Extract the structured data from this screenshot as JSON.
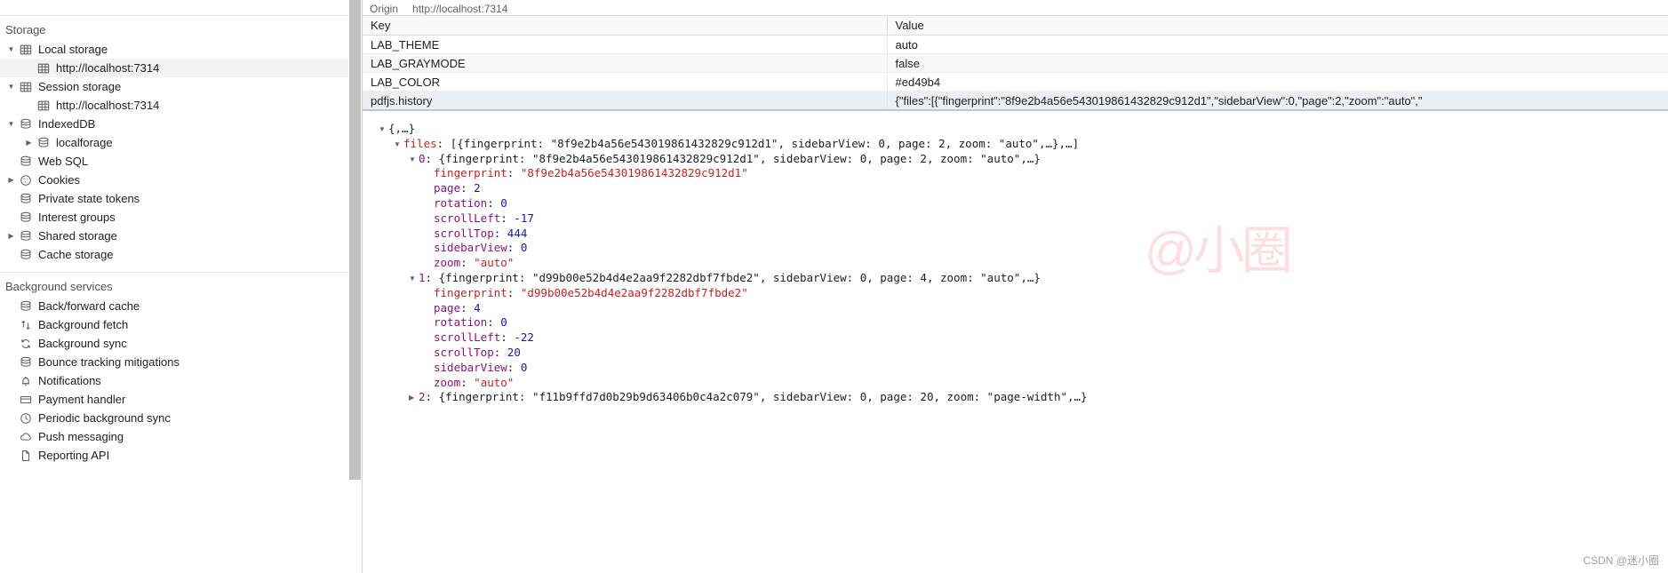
{
  "sidebar": {
    "sections": [
      {
        "title": "Storage",
        "items": [
          {
            "label": "Local storage",
            "icon": "table-icon",
            "indent": 0,
            "twisty": "down",
            "selected": false
          },
          {
            "label": "http://localhost:7314",
            "icon": "table-icon",
            "indent": 1,
            "twisty": "none",
            "selected": true
          },
          {
            "label": "Session storage",
            "icon": "table-icon",
            "indent": 0,
            "twisty": "down",
            "selected": false
          },
          {
            "label": "http://localhost:7314",
            "icon": "table-icon",
            "indent": 1,
            "twisty": "none",
            "selected": false
          },
          {
            "label": "IndexedDB",
            "icon": "database-icon",
            "indent": 0,
            "twisty": "down",
            "selected": false
          },
          {
            "label": "localforage",
            "icon": "database-icon",
            "indent": 1,
            "twisty": "right",
            "selected": false
          },
          {
            "label": "Web SQL",
            "icon": "database-icon",
            "indent": 0,
            "twisty": "none",
            "selected": false
          },
          {
            "label": "Cookies",
            "icon": "cookie-icon",
            "indent": 0,
            "twisty": "right",
            "selected": false
          },
          {
            "label": "Private state tokens",
            "icon": "database-icon",
            "indent": 0,
            "twisty": "none",
            "selected": false
          },
          {
            "label": "Interest groups",
            "icon": "database-icon",
            "indent": 0,
            "twisty": "none",
            "selected": false
          },
          {
            "label": "Shared storage",
            "icon": "database-icon",
            "indent": 0,
            "twisty": "right",
            "selected": false
          },
          {
            "label": "Cache storage",
            "icon": "database-icon",
            "indent": 0,
            "twisty": "none",
            "selected": false
          }
        ]
      },
      {
        "title": "Background services",
        "items": [
          {
            "label": "Back/forward cache",
            "icon": "database-icon",
            "indent": 0,
            "twisty": "none",
            "selected": false
          },
          {
            "label": "Background fetch",
            "icon": "updown-arrow-icon",
            "indent": 0,
            "twisty": "none",
            "selected": false
          },
          {
            "label": "Background sync",
            "icon": "sync-icon",
            "indent": 0,
            "twisty": "none",
            "selected": false
          },
          {
            "label": "Bounce tracking mitigations",
            "icon": "database-icon",
            "indent": 0,
            "twisty": "none",
            "selected": false
          },
          {
            "label": "Notifications",
            "icon": "bell-icon",
            "indent": 0,
            "twisty": "none",
            "selected": false
          },
          {
            "label": "Payment handler",
            "icon": "card-icon",
            "indent": 0,
            "twisty": "none",
            "selected": false
          },
          {
            "label": "Periodic background sync",
            "icon": "clock-icon",
            "indent": 0,
            "twisty": "none",
            "selected": false
          },
          {
            "label": "Push messaging",
            "icon": "cloud-icon",
            "indent": 0,
            "twisty": "none",
            "selected": false
          },
          {
            "label": "Reporting API",
            "icon": "document-icon",
            "indent": 0,
            "twisty": "none",
            "selected": false
          }
        ]
      }
    ]
  },
  "panel": {
    "origin_label": "Origin",
    "origin_value": "http://localhost:7314",
    "columns": {
      "key": "Key",
      "value": "Value"
    },
    "rows": [
      {
        "key": "LAB_THEME",
        "value": "auto",
        "selected": false
      },
      {
        "key": "LAB_GRAYMODE",
        "value": "false",
        "selected": false
      },
      {
        "key": "LAB_COLOR",
        "value": "#ed49b4",
        "selected": false
      },
      {
        "key": "pdfjs.history",
        "value": "{\"files\":[{\"fingerprint\":\"8f9e2b4a56e543019861432829c912d1\",\"sidebarView\":0,\"page\":2,\"zoom\":\"auto\",\"",
        "selected": true
      }
    ]
  },
  "preview": {
    "lines": [
      {
        "indent": 0,
        "twisty": "down",
        "segments": [
          {
            "t": "{,…}",
            "c": "obj-txt"
          }
        ]
      },
      {
        "indent": 1,
        "twisty": "down",
        "segments": [
          {
            "t": "files",
            "c": "k-name"
          },
          {
            "t": ": [{fingerprint: ",
            "c": "punct"
          },
          {
            "t": "\"8f9e2b4a56e543019861432829c912d1\"",
            "c": "punct"
          },
          {
            "t": ", sidebarView: 0, page: 2, zoom: \"auto\",…},…]",
            "c": "punct"
          }
        ]
      },
      {
        "indent": 2,
        "twisty": "down",
        "segments": [
          {
            "t": "0",
            "c": "k-idx"
          },
          {
            "t": ": {fingerprint: \"8f9e2b4a56e543019861432829c912d1\", sidebarView: 0, page: 2, zoom: \"auto\",…}",
            "c": "punct"
          }
        ]
      },
      {
        "indent": 3,
        "twisty": "none",
        "segments": [
          {
            "t": "fingerprint",
            "c": "k-name"
          },
          {
            "t": ": ",
            "c": "punct"
          },
          {
            "t": "\"8f9e2b4a56e543019861432829c912d1\"",
            "c": "v-str"
          }
        ]
      },
      {
        "indent": 3,
        "twisty": "none",
        "segments": [
          {
            "t": "page",
            "c": "k-idx"
          },
          {
            "t": ": ",
            "c": "punct"
          },
          {
            "t": "2",
            "c": "v-num"
          }
        ]
      },
      {
        "indent": 3,
        "twisty": "none",
        "segments": [
          {
            "t": "rotation",
            "c": "k-idx"
          },
          {
            "t": ": ",
            "c": "punct"
          },
          {
            "t": "0",
            "c": "v-num"
          }
        ]
      },
      {
        "indent": 3,
        "twisty": "none",
        "segments": [
          {
            "t": "scrollLeft",
            "c": "k-idx"
          },
          {
            "t": ": ",
            "c": "punct"
          },
          {
            "t": "-17",
            "c": "v-num"
          }
        ]
      },
      {
        "indent": 3,
        "twisty": "none",
        "segments": [
          {
            "t": "scrollTop",
            "c": "k-idx"
          },
          {
            "t": ": ",
            "c": "punct"
          },
          {
            "t": "444",
            "c": "v-num"
          }
        ]
      },
      {
        "indent": 3,
        "twisty": "none",
        "segments": [
          {
            "t": "sidebarView",
            "c": "k-idx"
          },
          {
            "t": ": ",
            "c": "punct"
          },
          {
            "t": "0",
            "c": "v-num"
          }
        ]
      },
      {
        "indent": 3,
        "twisty": "none",
        "segments": [
          {
            "t": "zoom",
            "c": "k-idx"
          },
          {
            "t": ": ",
            "c": "punct"
          },
          {
            "t": "\"auto\"",
            "c": "v-str"
          }
        ]
      },
      {
        "indent": 2,
        "twisty": "down",
        "segments": [
          {
            "t": "1",
            "c": "k-idx"
          },
          {
            "t": ": {fingerprint: \"d99b00e52b4d4e2aa9f2282dbf7fbde2\", sidebarView: 0, page: 4, zoom: \"auto\",…}",
            "c": "punct"
          }
        ]
      },
      {
        "indent": 3,
        "twisty": "none",
        "segments": [
          {
            "t": "fingerprint",
            "c": "k-name"
          },
          {
            "t": ": ",
            "c": "punct"
          },
          {
            "t": "\"d99b00e52b4d4e2aa9f2282dbf7fbde2\"",
            "c": "v-str"
          }
        ]
      },
      {
        "indent": 3,
        "twisty": "none",
        "segments": [
          {
            "t": "page",
            "c": "k-idx"
          },
          {
            "t": ": ",
            "c": "punct"
          },
          {
            "t": "4",
            "c": "v-num"
          }
        ]
      },
      {
        "indent": 3,
        "twisty": "none",
        "segments": [
          {
            "t": "rotation",
            "c": "k-idx"
          },
          {
            "t": ": ",
            "c": "punct"
          },
          {
            "t": "0",
            "c": "v-num"
          }
        ]
      },
      {
        "indent": 3,
        "twisty": "none",
        "segments": [
          {
            "t": "scrollLeft",
            "c": "k-idx"
          },
          {
            "t": ": ",
            "c": "punct"
          },
          {
            "t": "-22",
            "c": "v-num"
          }
        ]
      },
      {
        "indent": 3,
        "twisty": "none",
        "segments": [
          {
            "t": "scrollTop",
            "c": "k-idx"
          },
          {
            "t": ": ",
            "c": "punct"
          },
          {
            "t": "20",
            "c": "v-num"
          }
        ]
      },
      {
        "indent": 3,
        "twisty": "none",
        "segments": [
          {
            "t": "sidebarView",
            "c": "k-idx"
          },
          {
            "t": ": ",
            "c": "punct"
          },
          {
            "t": "0",
            "c": "v-num"
          }
        ]
      },
      {
        "indent": 3,
        "twisty": "none",
        "segments": [
          {
            "t": "zoom",
            "c": "k-idx"
          },
          {
            "t": ": ",
            "c": "punct"
          },
          {
            "t": "\"auto\"",
            "c": "v-str"
          }
        ]
      },
      {
        "indent": 2,
        "twisty": "right",
        "segments": [
          {
            "t": "2",
            "c": "k-idx"
          },
          {
            "t": ": {fingerprint: \"f11b9ffd7d0b29b9d63406b0c4a2c079\", sidebarView: 0, page: 20, zoom: \"page-width\",…}",
            "c": "punct"
          }
        ]
      }
    ]
  },
  "watermark": {
    "text": "@小圈"
  },
  "credit": {
    "text": "CSDN @迷小圈"
  },
  "colors": {
    "selection": "#eceff1",
    "accent": "#1a73e8",
    "key_name": "#c5221f",
    "key_index": "#881280",
    "number": "#1a1aa6"
  }
}
